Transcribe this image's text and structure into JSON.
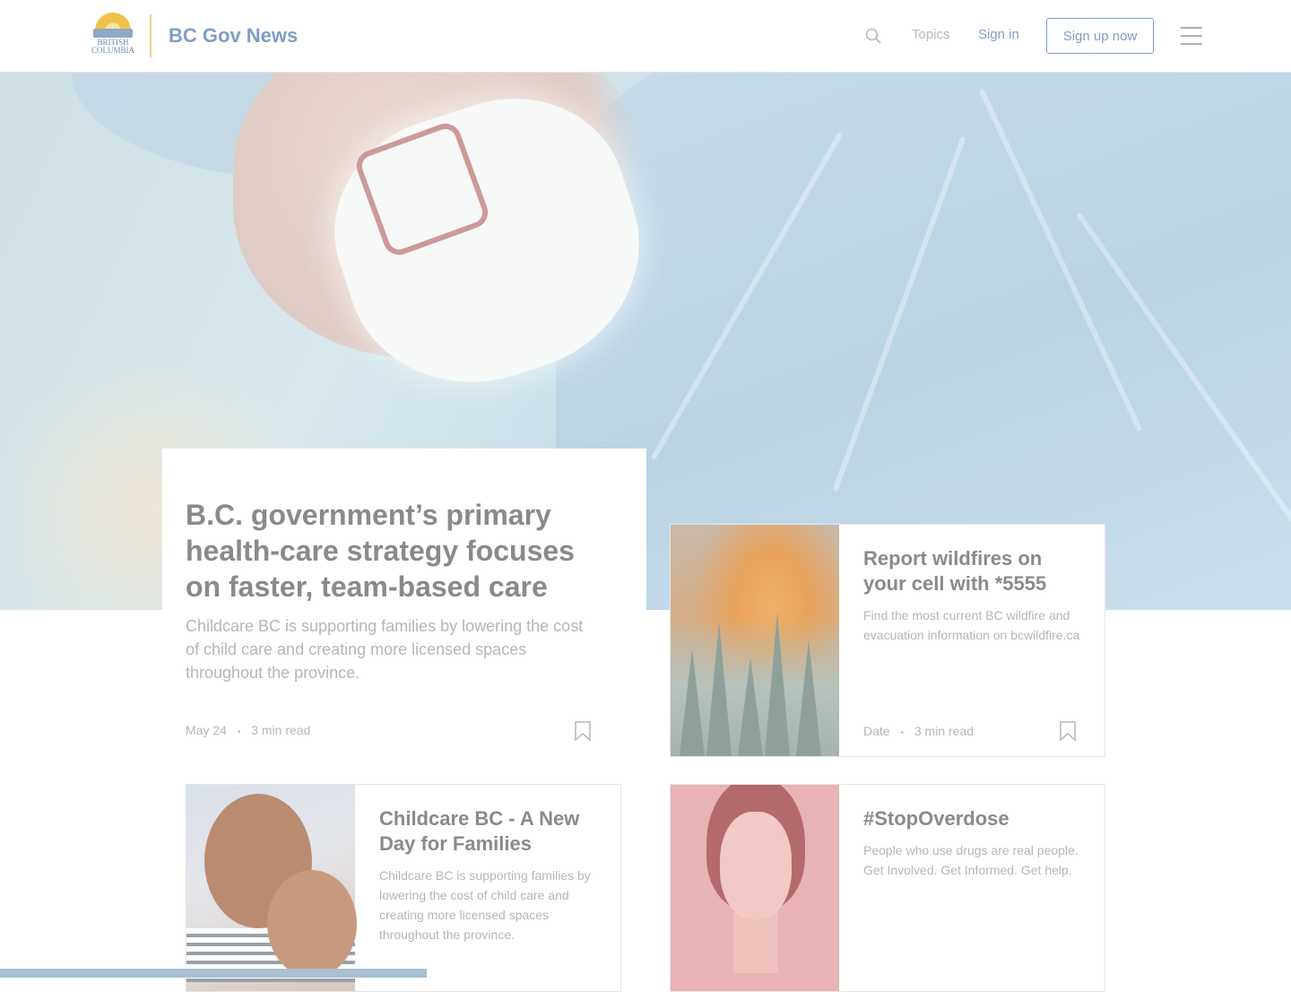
{
  "header": {
    "logo_text": "BRITISH COLUMBIA",
    "site_title": "BC Gov News",
    "nav_topics": "Topics",
    "nav_signin": "Sign in",
    "signup_label": "Sign up now"
  },
  "feature": {
    "title": "B.C. government’s primary health-care strategy focuses on faster, team-based care",
    "summary": "Childcare BC is supporting families by lowering the cost of child care and creating more licensed spaces throughout the province.",
    "date": "May 24",
    "separator": "•",
    "read_time": "3 min read"
  },
  "cards": [
    {
      "title": "Report wildfires on your cell with *5555",
      "summary": "Find the most current BC wildfire and evacuation information on bcwildfire.ca",
      "date": "Date",
      "separator": "•",
      "read_time": "3 min read"
    },
    {
      "title": "Childcare BC - A New Day for Families",
      "summary": "Childcare BC is supporting families by lowering the cost of child care and creating more licensed spaces throughout the province."
    },
    {
      "title": "#StopOverdose",
      "summary": "People who use drugs are real people. Get Involved. Get Informed. Get help."
    }
  ],
  "colors": {
    "brand_blue": "#7f9dc4",
    "accent_gold": "#f2d58a",
    "text_gray": "#8a8a8a"
  },
  "icons": {
    "search": "search-icon",
    "menu": "hamburger-menu-icon",
    "bookmark": "bookmark-icon"
  }
}
